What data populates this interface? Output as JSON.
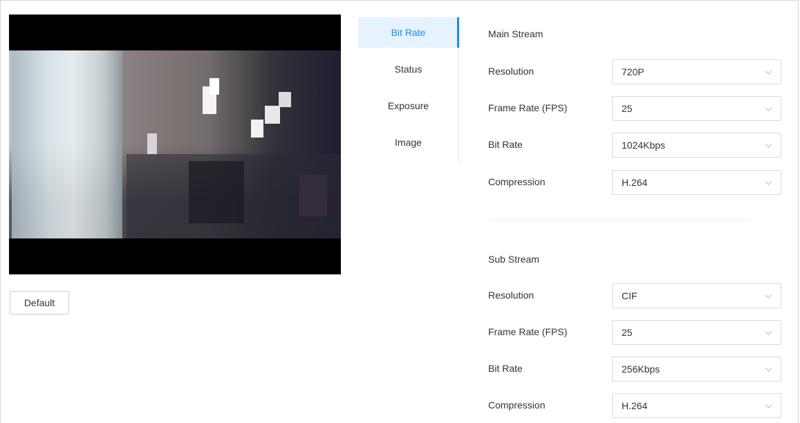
{
  "preview": {
    "default_button_label": "Default"
  },
  "tabs": [
    {
      "label": "Bit Rate",
      "active": true
    },
    {
      "label": "Status",
      "active": false
    },
    {
      "label": "Exposure",
      "active": false
    },
    {
      "label": "Image",
      "active": false
    }
  ],
  "main_stream": {
    "title": "Main Stream",
    "fields": [
      {
        "label": "Resolution",
        "value": "720P"
      },
      {
        "label": "Frame Rate (FPS)",
        "value": "25"
      },
      {
        "label": "Bit Rate",
        "value": "1024Kbps"
      },
      {
        "label": "Compression",
        "value": "H.264"
      }
    ]
  },
  "sub_stream": {
    "title": "Sub Stream",
    "fields": [
      {
        "label": "Resolution",
        "value": "CIF"
      },
      {
        "label": "Frame Rate (FPS)",
        "value": "25"
      },
      {
        "label": "Bit Rate",
        "value": "256Kbps"
      },
      {
        "label": "Compression",
        "value": "H.264"
      }
    ]
  },
  "colors": {
    "accent": "#1c8ceb",
    "active_tab_bg": "#e6f3ff",
    "border": "#d9d9d9"
  },
  "icons": {
    "select_arrow": "chevron-down-icon"
  }
}
